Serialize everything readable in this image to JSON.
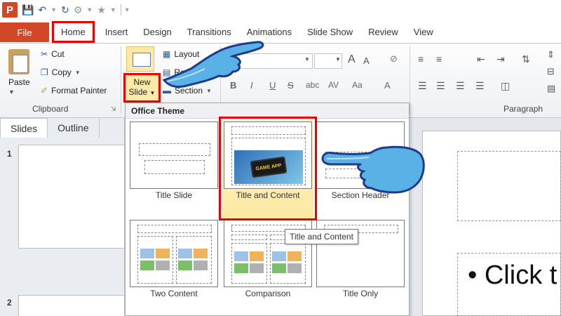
{
  "app": {
    "icon_letter": "P",
    "icons": [
      "save-icon",
      "undo-icon",
      "redo-icon",
      "repeat-icon",
      "star-icon"
    ]
  },
  "tabs": {
    "file": "File",
    "items": [
      "Home",
      "Insert",
      "Design",
      "Transitions",
      "Animations",
      "Slide Show",
      "Review",
      "View"
    ],
    "active": "Home"
  },
  "ribbon": {
    "clipboard": {
      "paste": "Paste",
      "cut": "Cut",
      "copy": "Copy",
      "format_painter": "Format Painter",
      "group_label": "Clipboard"
    },
    "slides": {
      "new_slide_line1": "New",
      "new_slide_line2": "Slide",
      "layout": "Layout",
      "reset": "Reset",
      "section": "Section"
    },
    "font": {
      "buttons": [
        "B",
        "I",
        "U",
        "S",
        "abc",
        "AV",
        "Aa",
        "A"
      ],
      "grow": "A",
      "shrink": "A"
    },
    "paragraph": {
      "group_label": "Paragraph"
    }
  },
  "slide_pane": {
    "tabs": [
      "Slides",
      "Outline"
    ],
    "active_tab": "Slides",
    "slide_numbers": [
      "1",
      "2"
    ]
  },
  "gallery": {
    "header": "Office Theme",
    "layouts": [
      {
        "name": "Title Slide"
      },
      {
        "name": "Title and Content",
        "selected": true
      },
      {
        "name": "Section Header"
      },
      {
        "name": "Two Content"
      },
      {
        "name": "Comparison"
      },
      {
        "name": "Title Only"
      }
    ],
    "picture_text": "GAME APP",
    "tooltip": "Title and Content"
  },
  "editor": {
    "body_placeholder": "•  Click t"
  },
  "colors": {
    "accent": "#d24726",
    "highlight": "#e00000",
    "selected_fill": "#fde8a0",
    "hand_fill": "#4aa3df"
  }
}
